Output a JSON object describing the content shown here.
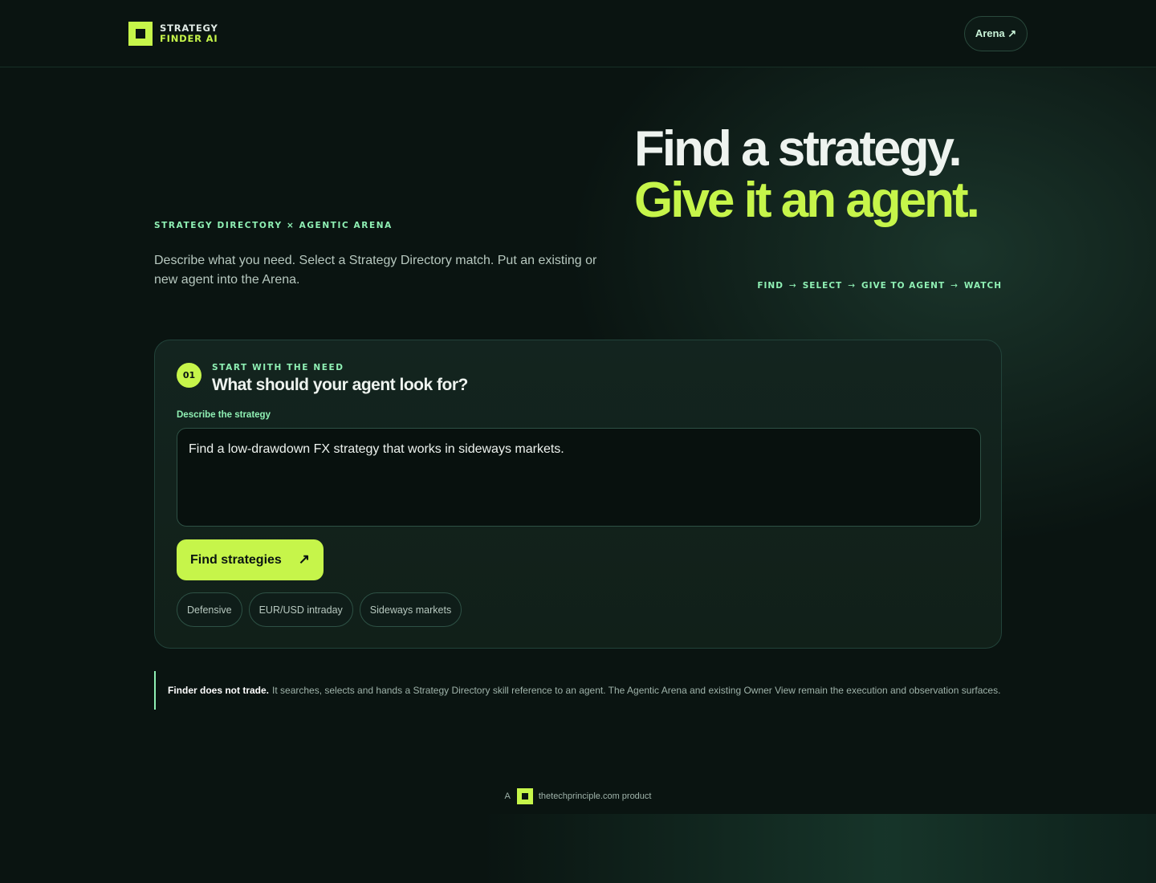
{
  "header": {
    "logo_line1": "STRATEGY",
    "logo_line2": "FINDER AI",
    "arena_link": "Arena ↗"
  },
  "hero": {
    "title_line1": "Find a strategy.",
    "title_line2": "Give it an agent.",
    "eyebrow": "STRATEGY DIRECTORY × AGENTIC ARENA",
    "intro": "Describe what you need. Select a Strategy Directory match. Put an existing or new agent into the Arena.",
    "steps": [
      "FIND",
      "SELECT",
      "GIVE TO AGENT",
      "WATCH"
    ],
    "step_arrow": "→"
  },
  "card": {
    "step_number": "01",
    "eyebrow": "START WITH THE NEED",
    "title": "What should your agent look for?",
    "field_label": "Describe the strategy",
    "field_value": "Find a low-drawdown FX strategy that works in sideways markets.",
    "button_label": "Find strategies",
    "button_icon": "↗",
    "chips": [
      "Defensive",
      "EUR/USD intraday",
      "Sideways markets"
    ]
  },
  "note": {
    "strong": "Finder does not trade.",
    "text": "It searches, selects and hands a Strategy Directory skill reference to an agent. The Agentic Arena and existing Owner View remain the execution and observation surfaces."
  },
  "footer": {
    "prefix": "A",
    "text": "thetechprinciple.com product"
  },
  "colors": {
    "background": "#0a1411",
    "accent": "#c6f54a",
    "mint": "#8ff0b4"
  }
}
